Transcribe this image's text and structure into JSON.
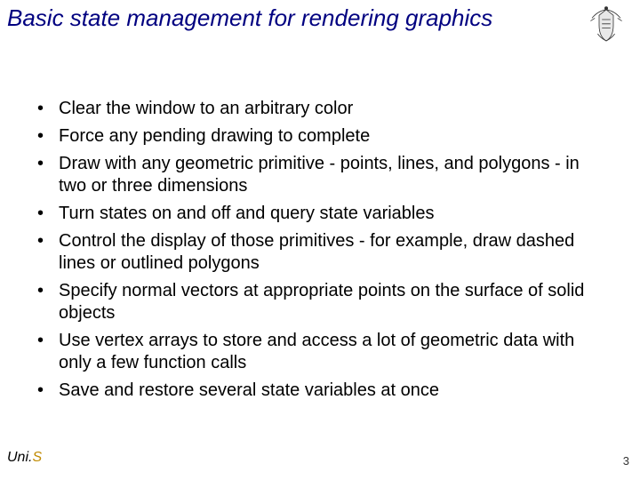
{
  "title": "Basic state management for rendering graphics",
  "bullets": [
    "Clear the window to an arbitrary color",
    "Force any pending drawing to complete",
    "Draw with any geometric primitive - points, lines, and polygons - in two or three dimensions",
    "Turn states on and off and query state variables",
    "Control the display of those primitives - for example, draw dashed lines or outlined polygons",
    "Specify normal vectors at appropriate points on the surface of solid objects",
    "Use vertex arrays to store and access a lot of geometric data with only a few function calls",
    "Save and restore several state variables at once"
  ],
  "footer": {
    "brand_prefix": "Uni.",
    "brand_suffix": "S",
    "page_number": "3"
  }
}
